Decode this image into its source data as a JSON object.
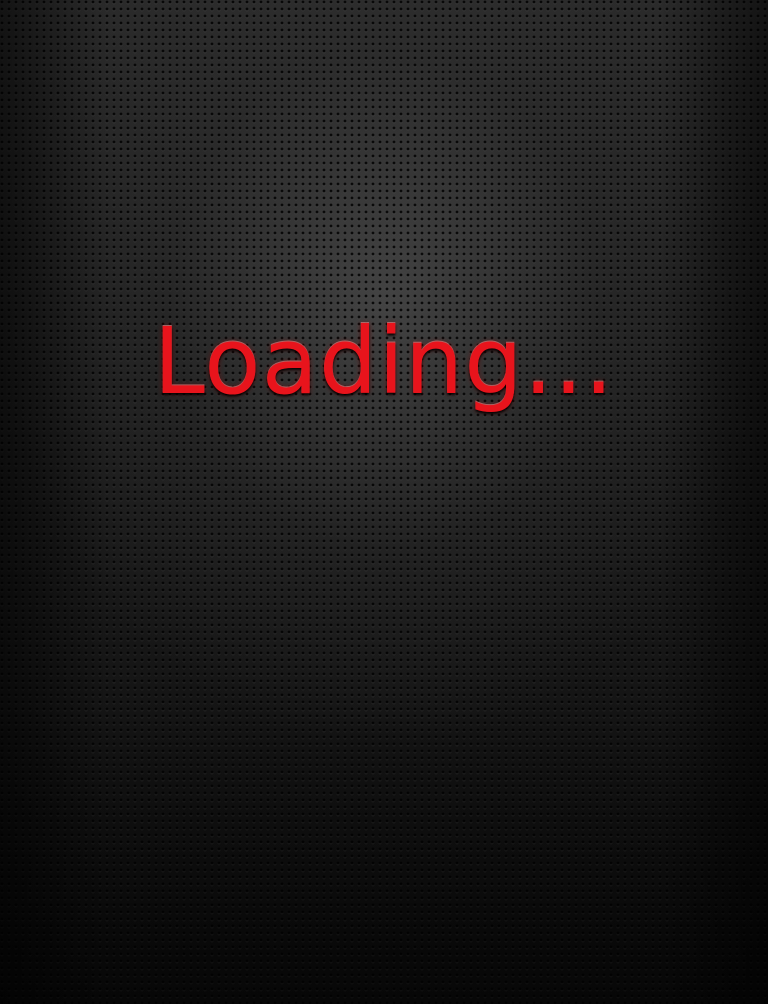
{
  "screen": {
    "loading_label": "Loading...",
    "accent_color": "#e8141c",
    "background_style": "dark perforated metal"
  }
}
